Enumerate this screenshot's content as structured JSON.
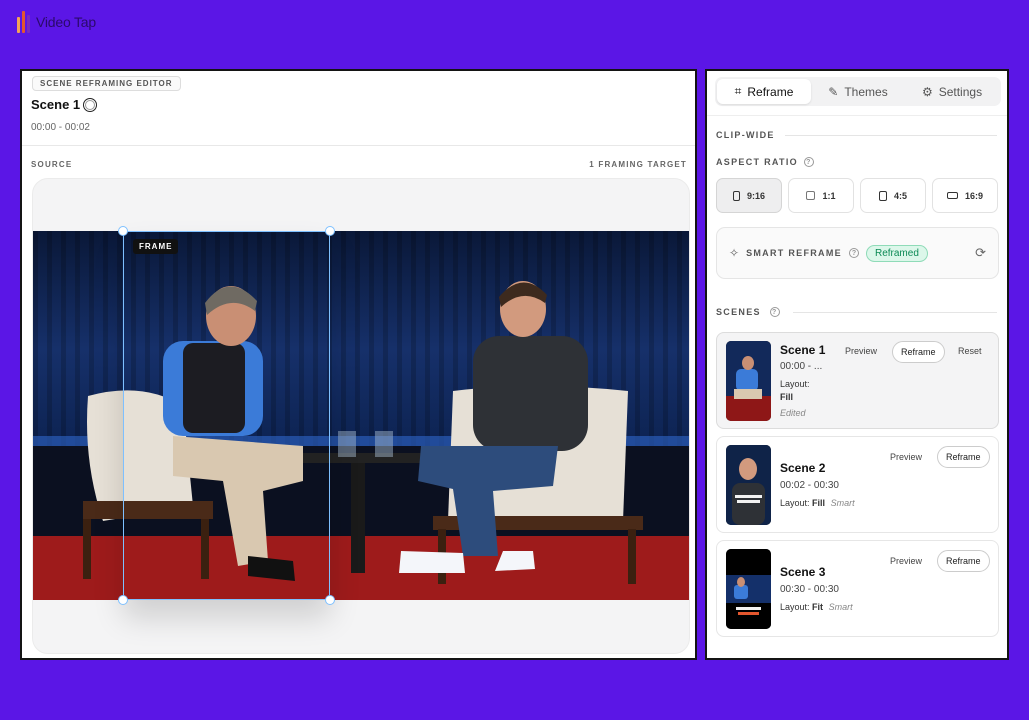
{
  "app": {
    "name": "Video Tap",
    "logo_colors": [
      "#f4a259",
      "#e4572e",
      "#7b2cbf"
    ]
  },
  "editor": {
    "badge": "SCENE REFRAMING EDITOR",
    "scene_title": "Scene 1",
    "scene_time": "00:00 - 00:02",
    "source_label": "SOURCE",
    "target_label": "1 FRAMING TARGET",
    "frame_tag": "FRAME"
  },
  "sidebar": {
    "tabs": [
      {
        "label": "Reframe",
        "icon": "crop-icon",
        "active": true
      },
      {
        "label": "Themes",
        "icon": "brush-icon",
        "active": false
      },
      {
        "label": "Settings",
        "icon": "sliders-icon",
        "active": false
      }
    ],
    "clip_wide_label": "CLIP-WIDE",
    "aspect_ratio_label": "ASPECT RATIO",
    "ratios": [
      {
        "label": "9:16",
        "active": true
      },
      {
        "label": "1:1",
        "active": false
      },
      {
        "label": "4:5",
        "active": false
      },
      {
        "label": "16:9",
        "active": false
      }
    ],
    "smart_reframe_label": "SMART REFRAME",
    "smart_reframe_status": "Reframed",
    "scenes_label": "SCENES",
    "scenes": [
      {
        "title": "Scene 1",
        "time": "00:00 - ...",
        "layout_prefix": "Layout:",
        "layout": "Fill",
        "note": "Edited",
        "preview": "Preview",
        "reframe": "Reframe",
        "reset": "Reset"
      },
      {
        "title": "Scene 2",
        "time": "00:02 - 00:30",
        "layout_prefix": "Layout:",
        "layout": "Fill",
        "note": "Smart",
        "preview": "Preview",
        "reframe": "Reframe"
      },
      {
        "title": "Scene 3",
        "time": "00:30 - 00:30",
        "layout_prefix": "Layout:",
        "layout": "Fit",
        "note": "Smart",
        "preview": "Preview",
        "reframe": "Reframe"
      }
    ]
  }
}
